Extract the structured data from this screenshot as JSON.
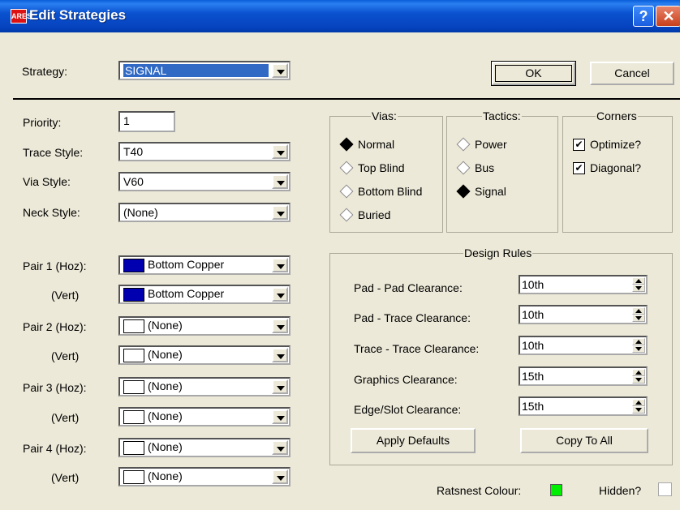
{
  "window": {
    "title": "Edit Strategies",
    "app_badge": "ARES"
  },
  "strategy": {
    "label": "Strategy:",
    "value": "SIGNAL"
  },
  "buttons": {
    "ok": "OK",
    "cancel": "Cancel",
    "apply_defaults": "Apply Defaults",
    "copy_to_all": "Copy To All"
  },
  "fields": {
    "priority": {
      "label": "Priority:",
      "value": "1"
    },
    "trace_style": {
      "label": "Trace Style:",
      "value": "T40"
    },
    "via_style": {
      "label": "Via Style:",
      "value": "V60"
    },
    "neck_style": {
      "label": "Neck Style:",
      "value": "(None)"
    }
  },
  "pairs": [
    {
      "label": "Pair 1 (Hoz):",
      "value": "Bottom Copper",
      "color": "#0000b0"
    },
    {
      "label": "(Vert)",
      "value": "Bottom Copper",
      "color": "#0000b0"
    },
    {
      "label": "Pair 2 (Hoz):",
      "value": "(None)",
      "color": "#ffffff"
    },
    {
      "label": "(Vert)",
      "value": "(None)",
      "color": "#ffffff"
    },
    {
      "label": "Pair 3 (Hoz):",
      "value": "(None)",
      "color": "#ffffff"
    },
    {
      "label": "(Vert)",
      "value": "(None)",
      "color": "#ffffff"
    },
    {
      "label": "Pair 4 (Hoz):",
      "value": "(None)",
      "color": "#ffffff"
    },
    {
      "label": "(Vert)",
      "value": "(None)",
      "color": "#ffffff"
    }
  ],
  "vias": {
    "title": "Vias:",
    "options": [
      "Normal",
      "Top Blind",
      "Bottom Blind",
      "Buried"
    ],
    "selected": "Normal"
  },
  "tactics": {
    "title": "Tactics:",
    "options": [
      "Power",
      "Bus",
      "Signal"
    ],
    "selected": "Signal"
  },
  "corners": {
    "title": "Corners",
    "options": [
      {
        "label": "Optimize?",
        "checked": true
      },
      {
        "label": "Diagonal?",
        "checked": true
      }
    ]
  },
  "design_rules": {
    "title": "Design Rules",
    "rows": [
      {
        "label": "Pad - Pad Clearance:",
        "value": "10th"
      },
      {
        "label": "Pad - Trace Clearance:",
        "value": "10th"
      },
      {
        "label": "Trace - Trace Clearance:",
        "value": "10th"
      },
      {
        "label": "Graphics Clearance:",
        "value": "15th"
      },
      {
        "label": "Edge/Slot Clearance:",
        "value": "15th"
      }
    ]
  },
  "ratsnest": {
    "label": "Ratsnest Colour:",
    "color": "#00ee00"
  },
  "hidden": {
    "label": "Hidden?",
    "checked": false
  }
}
